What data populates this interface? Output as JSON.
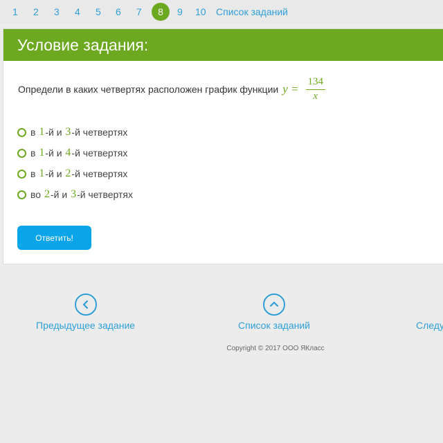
{
  "pagination": {
    "pages": [
      "1",
      "2",
      "3",
      "4",
      "5",
      "6",
      "7",
      "8",
      "9",
      "10"
    ],
    "active": "8",
    "task_list_label": "Список заданий"
  },
  "task": {
    "header": "Условие задания:",
    "question_text": "Определи в каких четвертях расположен график функции",
    "formula": {
      "lhs": "y =",
      "numerator": "134",
      "denominator": "x"
    },
    "options": [
      {
        "prefix": "в",
        "a": "1",
        "mid": "-й и",
        "b": "3",
        "suffix": "-й четвертях"
      },
      {
        "prefix": "в",
        "a": "1",
        "mid": "-й и",
        "b": "4",
        "suffix": "-й четвертях"
      },
      {
        "prefix": "в",
        "a": "1",
        "mid": "-й и",
        "b": "2",
        "suffix": "-й четвертях"
      },
      {
        "prefix": "во",
        "a": "2",
        "mid": "-й и",
        "b": "3",
        "suffix": "-й четвертях"
      }
    ],
    "submit_label": "Ответить!"
  },
  "bottom_nav": {
    "previous_label": "Предыдущее задание",
    "list_label": "Список заданий",
    "next_label": "Следу"
  },
  "copyright": "Copyright © 2017 ООО ЯКласс",
  "colors": {
    "accent_green": "#6da821",
    "link_blue": "#2e9fd8",
    "button_blue": "#0aa4e8"
  }
}
